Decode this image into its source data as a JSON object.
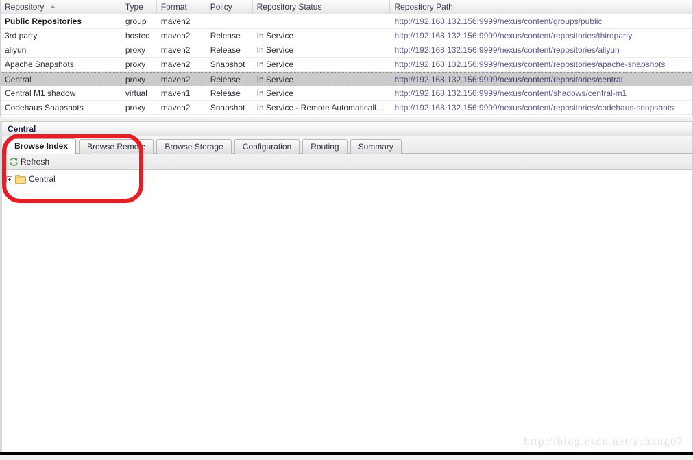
{
  "grid": {
    "columns": [
      {
        "key": "repository",
        "label": "Repository",
        "sorted": "asc"
      },
      {
        "key": "type",
        "label": "Type"
      },
      {
        "key": "format",
        "label": "Format"
      },
      {
        "key": "policy",
        "label": "Policy"
      },
      {
        "key": "status",
        "label": "Repository Status"
      },
      {
        "key": "path",
        "label": "Repository Path"
      }
    ],
    "rows": [
      {
        "repository": "Public Repositories",
        "type": "group",
        "format": "maven2",
        "policy": "",
        "status": "",
        "path": "http://192.168.132.156:9999/nexus/content/groups/public",
        "bold": true,
        "selected": false
      },
      {
        "repository": "3rd party",
        "type": "hosted",
        "format": "maven2",
        "policy": "Release",
        "status": "In Service",
        "path": "http://192.168.132.156:9999/nexus/content/repositories/thirdparty",
        "bold": false,
        "selected": false
      },
      {
        "repository": "aliyun",
        "type": "proxy",
        "format": "maven2",
        "policy": "Release",
        "status": "In Service",
        "path": "http://192.168.132.156:9999/nexus/content/repositories/aliyun",
        "bold": false,
        "selected": false
      },
      {
        "repository": "Apache Snapshots",
        "type": "proxy",
        "format": "maven2",
        "policy": "Snapshot",
        "status": "In Service",
        "path": "http://192.168.132.156:9999/nexus/content/repositories/apache-snapshots",
        "bold": false,
        "selected": false
      },
      {
        "repository": "Central",
        "type": "proxy",
        "format": "maven2",
        "policy": "Release",
        "status": "In Service",
        "path": "http://192.168.132.156:9999/nexus/content/repositories/central",
        "bold": false,
        "selected": true
      },
      {
        "repository": "Central M1 shadow",
        "type": "virtual",
        "format": "maven1",
        "policy": "Release",
        "status": "In Service",
        "path": "http://192.168.132.156:9999/nexus/content/shadows/central-m1",
        "bold": false,
        "selected": false
      },
      {
        "repository": "Codehaus Snapshots",
        "type": "proxy",
        "format": "maven2",
        "policy": "Snapshot",
        "status": "In Service - Remote Automaticall…",
        "path": "http://192.168.132.156:9999/nexus/content/repositories/codehaus-snapshots",
        "bold": false,
        "selected": false
      }
    ]
  },
  "detail": {
    "title": "Central",
    "tabs": [
      {
        "label": "Browse Index",
        "active": true
      },
      {
        "label": "Browse Remote",
        "active": false
      },
      {
        "label": "Browse Storage",
        "active": false
      },
      {
        "label": "Configuration",
        "active": false
      },
      {
        "label": "Routing",
        "active": false
      },
      {
        "label": "Summary",
        "active": false
      }
    ],
    "toolbar": {
      "refresh_label": "Refresh",
      "refresh_icon": "refresh-icon"
    },
    "tree": {
      "root_label": "Central",
      "folder_icon": "folder-icon",
      "expander_state": "collapsed"
    }
  },
  "annotation": {
    "shape": "rounded-rectangle",
    "color": "#ea1c23"
  },
  "watermark": {
    "text": "http://blog.csdn.net/achang07"
  }
}
